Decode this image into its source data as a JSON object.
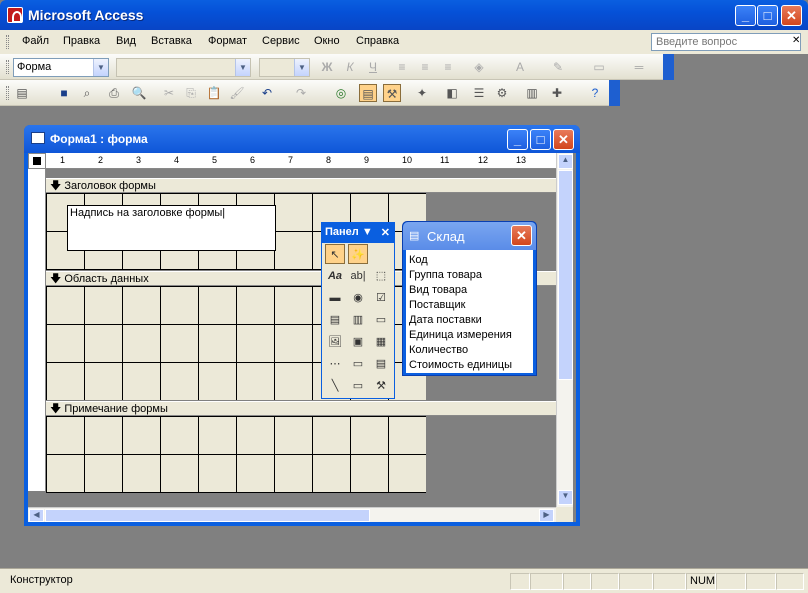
{
  "app": {
    "title": "Microsoft Access"
  },
  "menu": {
    "items": [
      "Файл",
      "Правка",
      "Вид",
      "Вставка",
      "Формат",
      "Сервис",
      "Окно",
      "Справка"
    ],
    "help_placeholder": "Введите вопрос"
  },
  "format_toolbar": {
    "object_combo": "Форма"
  },
  "form_window": {
    "title": "Форма1 : форма"
  },
  "ruler": {
    "ticks": [
      "1",
      "2",
      "3",
      "4",
      "5",
      "6",
      "7",
      "8",
      "9",
      "10",
      "11",
      "12",
      "13"
    ]
  },
  "sections": {
    "header": "Заголовок формы",
    "detail": "Область данных",
    "footer": "Примечание формы"
  },
  "label_box": {
    "text": "Надпись на заголовке формы"
  },
  "toolbox": {
    "title": "Панел"
  },
  "field_list": {
    "title": "Склад",
    "fields": [
      "Код",
      "Группа товара",
      "Вид товара",
      "Поставщик",
      "Дата поставки",
      "Единица измерения",
      "Количество",
      "Стоимость единицы"
    ]
  },
  "status": {
    "mode": "Конструктор",
    "num": "NUM"
  }
}
